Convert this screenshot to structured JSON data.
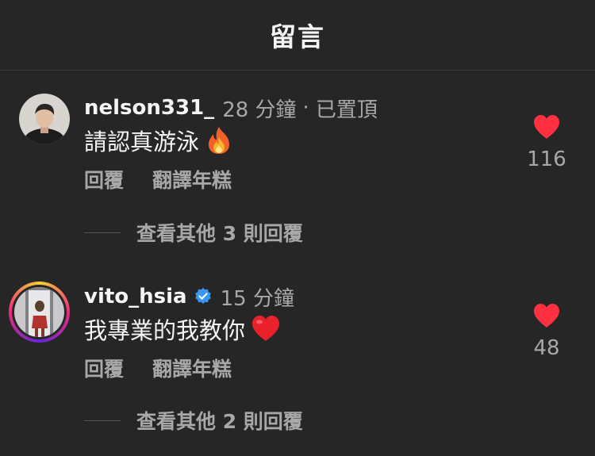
{
  "header": {
    "title": "留言"
  },
  "comments": [
    {
      "username": "nelson331_",
      "time": "28 分鐘",
      "pinned": "已置頂",
      "text": "請認真游泳",
      "emoji": "fire",
      "reply_label": "回覆",
      "translate_label": "翻譯年糕",
      "likes": "116",
      "view_replies": "查看其他 3 則回覆"
    },
    {
      "username": "vito_hsia",
      "verified": true,
      "time": "15 分鐘",
      "text": "我專業的我教你",
      "emoji": "red-heart",
      "reply_label": "回覆",
      "translate_label": "翻譯年糕",
      "likes": "48",
      "view_replies": "查看其他 2 則回覆"
    }
  ],
  "colors": {
    "background": "#262626",
    "heart": "#ff3040",
    "muted": "#a8a8a8",
    "verified": "#3797f0"
  }
}
